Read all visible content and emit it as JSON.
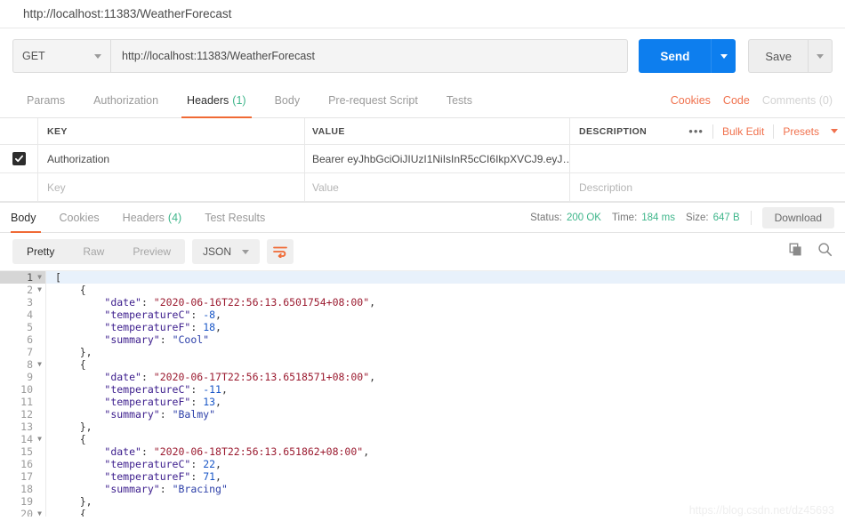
{
  "window": {
    "title": "http://localhost:11383/WeatherForecast"
  },
  "request": {
    "method": "GET",
    "url": "http://localhost:11383/WeatherForecast",
    "send_label": "Send",
    "save_label": "Save"
  },
  "request_tabs": {
    "items": [
      {
        "label": "Params",
        "count": "",
        "active": false
      },
      {
        "label": "Authorization",
        "count": "",
        "active": false
      },
      {
        "label": "Headers",
        "count": "(1)",
        "active": true
      },
      {
        "label": "Body",
        "count": "",
        "active": false
      },
      {
        "label": "Pre-request Script",
        "count": "",
        "active": false
      },
      {
        "label": "Tests",
        "count": "",
        "active": false
      }
    ],
    "actions": [
      {
        "label": "Cookies",
        "muted": false
      },
      {
        "label": "Code",
        "muted": false
      },
      {
        "label": "Comments (0)",
        "muted": true
      }
    ]
  },
  "headers_table": {
    "columns": {
      "key": "KEY",
      "value": "VALUE",
      "description": "DESCRIPTION"
    },
    "actions": {
      "dots": "•••",
      "bulk_edit": "Bulk Edit",
      "presets": "Presets"
    },
    "rows": [
      {
        "checked": true,
        "key": "Authorization",
        "value": "Bearer eyJhbGciOiJIUzI1NiIsInR5cCI6IkpXVCJ9.eyJ…",
        "description": ""
      }
    ],
    "placeholder_row": {
      "key": "Key",
      "value": "Value",
      "description": "Description"
    }
  },
  "response": {
    "tabs": [
      {
        "label": "Body",
        "count": "",
        "active": true
      },
      {
        "label": "Cookies",
        "count": "",
        "active": false
      },
      {
        "label": "Headers",
        "count": "(4)",
        "active": false
      },
      {
        "label": "Test Results",
        "count": "",
        "active": false
      }
    ],
    "status_label": "Status:",
    "status_value": "200 OK",
    "time_label": "Time:",
    "time_value": "184 ms",
    "size_label": "Size:",
    "size_value": "647 B",
    "download_label": "Download",
    "format_modes": [
      {
        "label": "Pretty",
        "active": true
      },
      {
        "label": "Raw",
        "active": false
      },
      {
        "label": "Preview",
        "active": false
      }
    ],
    "content_type": "JSON",
    "icons": {
      "wrap": "wrap-text-icon",
      "copy": "copy-icon",
      "search": "search-icon"
    }
  },
  "body": {
    "language": "json",
    "highlighted_line": 1,
    "lines": [
      {
        "n": 1,
        "fold": true,
        "tokens": [
          {
            "t": "[",
            "c": "p"
          }
        ]
      },
      {
        "n": 2,
        "fold": true,
        "tokens": [
          {
            "t": "    {",
            "c": "p"
          }
        ]
      },
      {
        "n": 3,
        "fold": false,
        "tokens": [
          {
            "t": "        ",
            "c": "p"
          },
          {
            "t": "\"date\"",
            "c": "k"
          },
          {
            "t": ": ",
            "c": "p"
          },
          {
            "t": "\"2020-06-16T22:56:13.6501754+08:00\"",
            "c": "s"
          },
          {
            "t": ",",
            "c": "p"
          }
        ]
      },
      {
        "n": 4,
        "fold": false,
        "tokens": [
          {
            "t": "        ",
            "c": "p"
          },
          {
            "t": "\"temperatureC\"",
            "c": "k"
          },
          {
            "t": ": ",
            "c": "p"
          },
          {
            "t": "-8",
            "c": "n"
          },
          {
            "t": ",",
            "c": "p"
          }
        ]
      },
      {
        "n": 5,
        "fold": false,
        "tokens": [
          {
            "t": "        ",
            "c": "p"
          },
          {
            "t": "\"temperatureF\"",
            "c": "k"
          },
          {
            "t": ": ",
            "c": "p"
          },
          {
            "t": "18",
            "c": "n"
          },
          {
            "t": ",",
            "c": "p"
          }
        ]
      },
      {
        "n": 6,
        "fold": false,
        "tokens": [
          {
            "t": "        ",
            "c": "p"
          },
          {
            "t": "\"summary\"",
            "c": "k"
          },
          {
            "t": ": ",
            "c": "p"
          },
          {
            "t": "\"Cool\"",
            "c": "sb"
          }
        ]
      },
      {
        "n": 7,
        "fold": false,
        "tokens": [
          {
            "t": "    },",
            "c": "p"
          }
        ]
      },
      {
        "n": 8,
        "fold": true,
        "tokens": [
          {
            "t": "    {",
            "c": "p"
          }
        ]
      },
      {
        "n": 9,
        "fold": false,
        "tokens": [
          {
            "t": "        ",
            "c": "p"
          },
          {
            "t": "\"date\"",
            "c": "k"
          },
          {
            "t": ": ",
            "c": "p"
          },
          {
            "t": "\"2020-06-17T22:56:13.6518571+08:00\"",
            "c": "s"
          },
          {
            "t": ",",
            "c": "p"
          }
        ]
      },
      {
        "n": 10,
        "fold": false,
        "tokens": [
          {
            "t": "        ",
            "c": "p"
          },
          {
            "t": "\"temperatureC\"",
            "c": "k"
          },
          {
            "t": ": ",
            "c": "p"
          },
          {
            "t": "-11",
            "c": "n"
          },
          {
            "t": ",",
            "c": "p"
          }
        ]
      },
      {
        "n": 11,
        "fold": false,
        "tokens": [
          {
            "t": "        ",
            "c": "p"
          },
          {
            "t": "\"temperatureF\"",
            "c": "k"
          },
          {
            "t": ": ",
            "c": "p"
          },
          {
            "t": "13",
            "c": "n"
          },
          {
            "t": ",",
            "c": "p"
          }
        ]
      },
      {
        "n": 12,
        "fold": false,
        "tokens": [
          {
            "t": "        ",
            "c": "p"
          },
          {
            "t": "\"summary\"",
            "c": "k"
          },
          {
            "t": ": ",
            "c": "p"
          },
          {
            "t": "\"Balmy\"",
            "c": "sb"
          }
        ]
      },
      {
        "n": 13,
        "fold": false,
        "tokens": [
          {
            "t": "    },",
            "c": "p"
          }
        ]
      },
      {
        "n": 14,
        "fold": true,
        "tokens": [
          {
            "t": "    {",
            "c": "p"
          }
        ]
      },
      {
        "n": 15,
        "fold": false,
        "tokens": [
          {
            "t": "        ",
            "c": "p"
          },
          {
            "t": "\"date\"",
            "c": "k"
          },
          {
            "t": ": ",
            "c": "p"
          },
          {
            "t": "\"2020-06-18T22:56:13.651862+08:00\"",
            "c": "s"
          },
          {
            "t": ",",
            "c": "p"
          }
        ]
      },
      {
        "n": 16,
        "fold": false,
        "tokens": [
          {
            "t": "        ",
            "c": "p"
          },
          {
            "t": "\"temperatureC\"",
            "c": "k"
          },
          {
            "t": ": ",
            "c": "p"
          },
          {
            "t": "22",
            "c": "n"
          },
          {
            "t": ",",
            "c": "p"
          }
        ]
      },
      {
        "n": 17,
        "fold": false,
        "tokens": [
          {
            "t": "        ",
            "c": "p"
          },
          {
            "t": "\"temperatureF\"",
            "c": "k"
          },
          {
            "t": ": ",
            "c": "p"
          },
          {
            "t": "71",
            "c": "n"
          },
          {
            "t": ",",
            "c": "p"
          }
        ]
      },
      {
        "n": 18,
        "fold": false,
        "tokens": [
          {
            "t": "        ",
            "c": "p"
          },
          {
            "t": "\"summary\"",
            "c": "k"
          },
          {
            "t": ": ",
            "c": "p"
          },
          {
            "t": "\"Bracing\"",
            "c": "sb"
          }
        ]
      },
      {
        "n": 19,
        "fold": false,
        "tokens": [
          {
            "t": "    },",
            "c": "p"
          }
        ]
      },
      {
        "n": 20,
        "fold": true,
        "tokens": [
          {
            "t": "    {",
            "c": "p"
          }
        ]
      }
    ]
  },
  "watermark": "https://blog.csdn.net/dz45693"
}
